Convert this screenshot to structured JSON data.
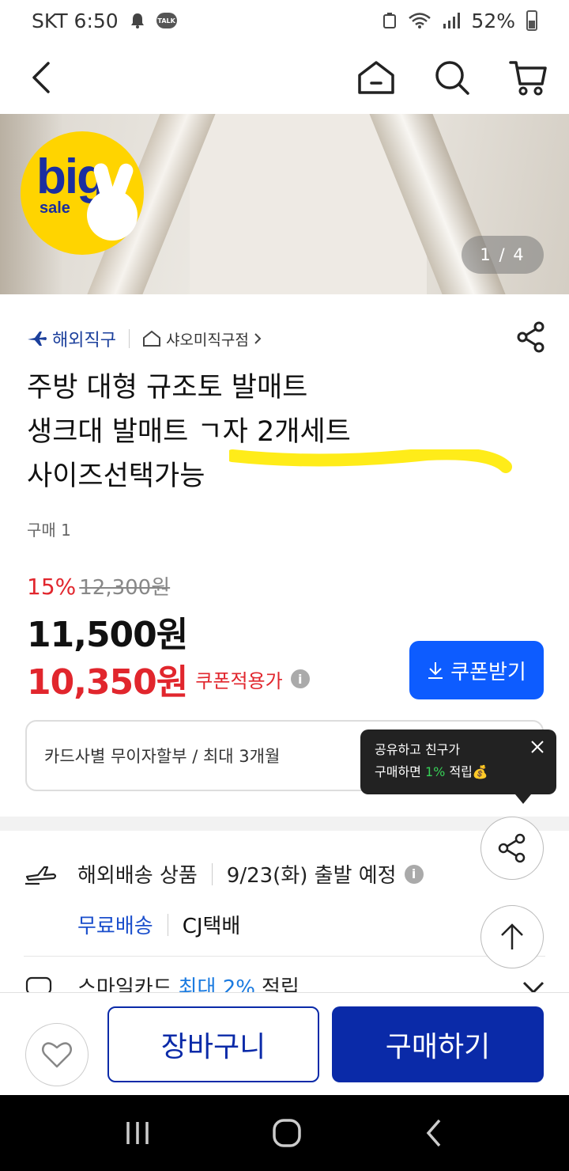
{
  "status_bar": {
    "carrier": "SKT",
    "time": "6:50",
    "talk": "TALK",
    "battery": "52%"
  },
  "hero": {
    "page_counter": "1 / 4",
    "promo_big": "big",
    "promo_sale": "sale"
  },
  "seller": {
    "overseas_label": "해외직구",
    "store_name": "샤오미직구점"
  },
  "product": {
    "title_line1": "주방 대형 규조토 발매트",
    "title_line2": "생크대 발매트 ㄱ자 2개세트",
    "title_line3": "사이즈선택가능",
    "purchase_count": "구매 1"
  },
  "pricing": {
    "discount_pct": "15%",
    "original_price": "12,300원",
    "price": "11,500원",
    "coupon_price": "10,350원",
    "coupon_applied_label": "쿠폰적용가",
    "coupon_button": "쿠폰받기"
  },
  "card_info": {
    "text": "카드사별 무이자할부 / 최대 3개월"
  },
  "tooltip": {
    "line1": "공유하고 친구가",
    "line2_prefix": "구매하면 ",
    "line2_pct": "1%",
    "line2_suffix": " 적립💰"
  },
  "shipping": {
    "type": "해외배송 상품",
    "departure": "9/23(화) 출발 예정",
    "free_shipping": "무료배송",
    "carrier": "CJ택배"
  },
  "smile_card": {
    "prefix": "스마일카드",
    "highlight": "최대 2%",
    "suffix": "적립"
  },
  "bottom_bar": {
    "cart_label": "장바구니",
    "buy_label": "구매하기"
  },
  "colors": {
    "primary_blue": "#0a2aa8",
    "accent_blue": "#0d5cff",
    "sale_red": "#e1262d",
    "highlight_yellow": "#ffea00"
  }
}
